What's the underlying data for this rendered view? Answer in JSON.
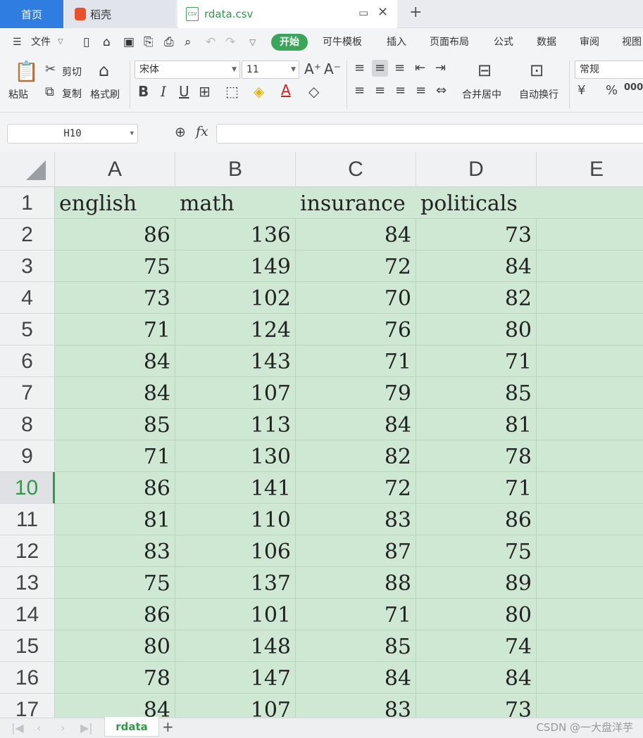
{
  "tabs": {
    "home": "首页",
    "daoke": "稻壳",
    "file": "rdata.csv",
    "file_icon": "CSV",
    "new_tab": "+"
  },
  "menu": {
    "file": "文件",
    "items": [
      "开始",
      "可牛模板",
      "插入",
      "页面布局",
      "公式",
      "数据",
      "审阅",
      "视图"
    ]
  },
  "ribbon": {
    "paste": "粘贴",
    "cut": "剪切",
    "copy": "复制",
    "format_painter": "格式刷",
    "font": "宋体",
    "font_size": "11",
    "bold": "B",
    "italic": "I",
    "underline": "U",
    "merge_center": "合并居中",
    "wrap": "自动换行",
    "number_format": "常规",
    "currency": "¥",
    "percent": "%",
    "thousands": "000"
  },
  "formula_bar": {
    "cell_ref": "H10",
    "fx": "fx",
    "formula": ""
  },
  "columns": [
    "A",
    "B",
    "C",
    "D",
    "E"
  ],
  "active_row": "10",
  "rows": [
    {
      "n": "1",
      "cells": [
        "english",
        "math",
        "insurance",
        "politicals"
      ]
    },
    {
      "n": "2",
      "cells": [
        "86",
        "136",
        "84",
        "73"
      ]
    },
    {
      "n": "3",
      "cells": [
        "75",
        "149",
        "72",
        "84"
      ]
    },
    {
      "n": "4",
      "cells": [
        "73",
        "102",
        "70",
        "82"
      ]
    },
    {
      "n": "5",
      "cells": [
        "71",
        "124",
        "76",
        "80"
      ]
    },
    {
      "n": "6",
      "cells": [
        "84",
        "143",
        "71",
        "71"
      ]
    },
    {
      "n": "7",
      "cells": [
        "84",
        "107",
        "79",
        "85"
      ]
    },
    {
      "n": "8",
      "cells": [
        "85",
        "113",
        "84",
        "81"
      ]
    },
    {
      "n": "9",
      "cells": [
        "71",
        "130",
        "82",
        "78"
      ]
    },
    {
      "n": "10",
      "cells": [
        "86",
        "141",
        "72",
        "71"
      ]
    },
    {
      "n": "11",
      "cells": [
        "81",
        "110",
        "83",
        "86"
      ]
    },
    {
      "n": "12",
      "cells": [
        "83",
        "106",
        "87",
        "75"
      ]
    },
    {
      "n": "13",
      "cells": [
        "75",
        "137",
        "88",
        "89"
      ]
    },
    {
      "n": "14",
      "cells": [
        "86",
        "101",
        "71",
        "80"
      ]
    },
    {
      "n": "15",
      "cells": [
        "80",
        "148",
        "85",
        "74"
      ]
    },
    {
      "n": "16",
      "cells": [
        "78",
        "147",
        "84",
        "84"
      ]
    },
    {
      "n": "17",
      "cells": [
        "84",
        "107",
        "83",
        "73"
      ]
    }
  ],
  "sheet": {
    "name": "rdata",
    "add": "+"
  },
  "watermark": "CSDN @一大盘洋芋",
  "colors": {
    "accent": "#3aa659",
    "cell_fill": "#cfe8d4",
    "home_tab": "#2f7de1"
  }
}
